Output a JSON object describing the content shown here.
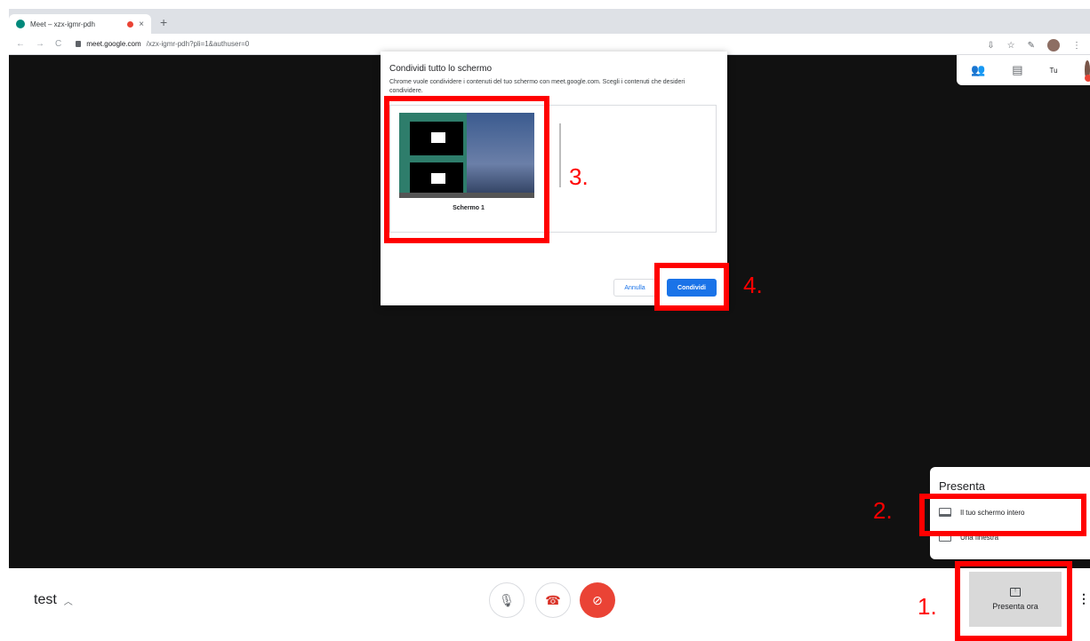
{
  "browser": {
    "tab_title": "Meet – xzx-igmr-pdh",
    "tab_close": "×",
    "new_tab": "+",
    "nav_back": "←",
    "nav_forward": "→",
    "nav_reload": "C",
    "url_host": "meet.google.com",
    "url_path": "/xzx-igmr-pdh?pli=1&authuser=0"
  },
  "participants": {
    "user_label": "Tu"
  },
  "dialog": {
    "title": "Condividi tutto lo schermo",
    "description": "Chrome vuole condividere i contenuti del tuo schermo con meet.google.com. Scegli i contenuti che desideri condividere.",
    "screen_label": "Schermo 1",
    "cancel_label": "Annulla",
    "share_label": "Condividi"
  },
  "present_menu": {
    "header": "Presenta",
    "items": [
      {
        "label": "Il tuo schermo intero",
        "icon": "laptop-icon"
      },
      {
        "label": "Una finestra",
        "icon": "window-icon"
      }
    ]
  },
  "bottombar": {
    "meeting_name": "test",
    "present_label": "Presenta ora"
  },
  "annotations": {
    "step1": "1.",
    "step2": "2.",
    "step3": "3.",
    "step4": "4."
  },
  "colors": {
    "accent": "#1a73e8",
    "annotation": "#ff0000",
    "hangup": "#ea4335"
  }
}
